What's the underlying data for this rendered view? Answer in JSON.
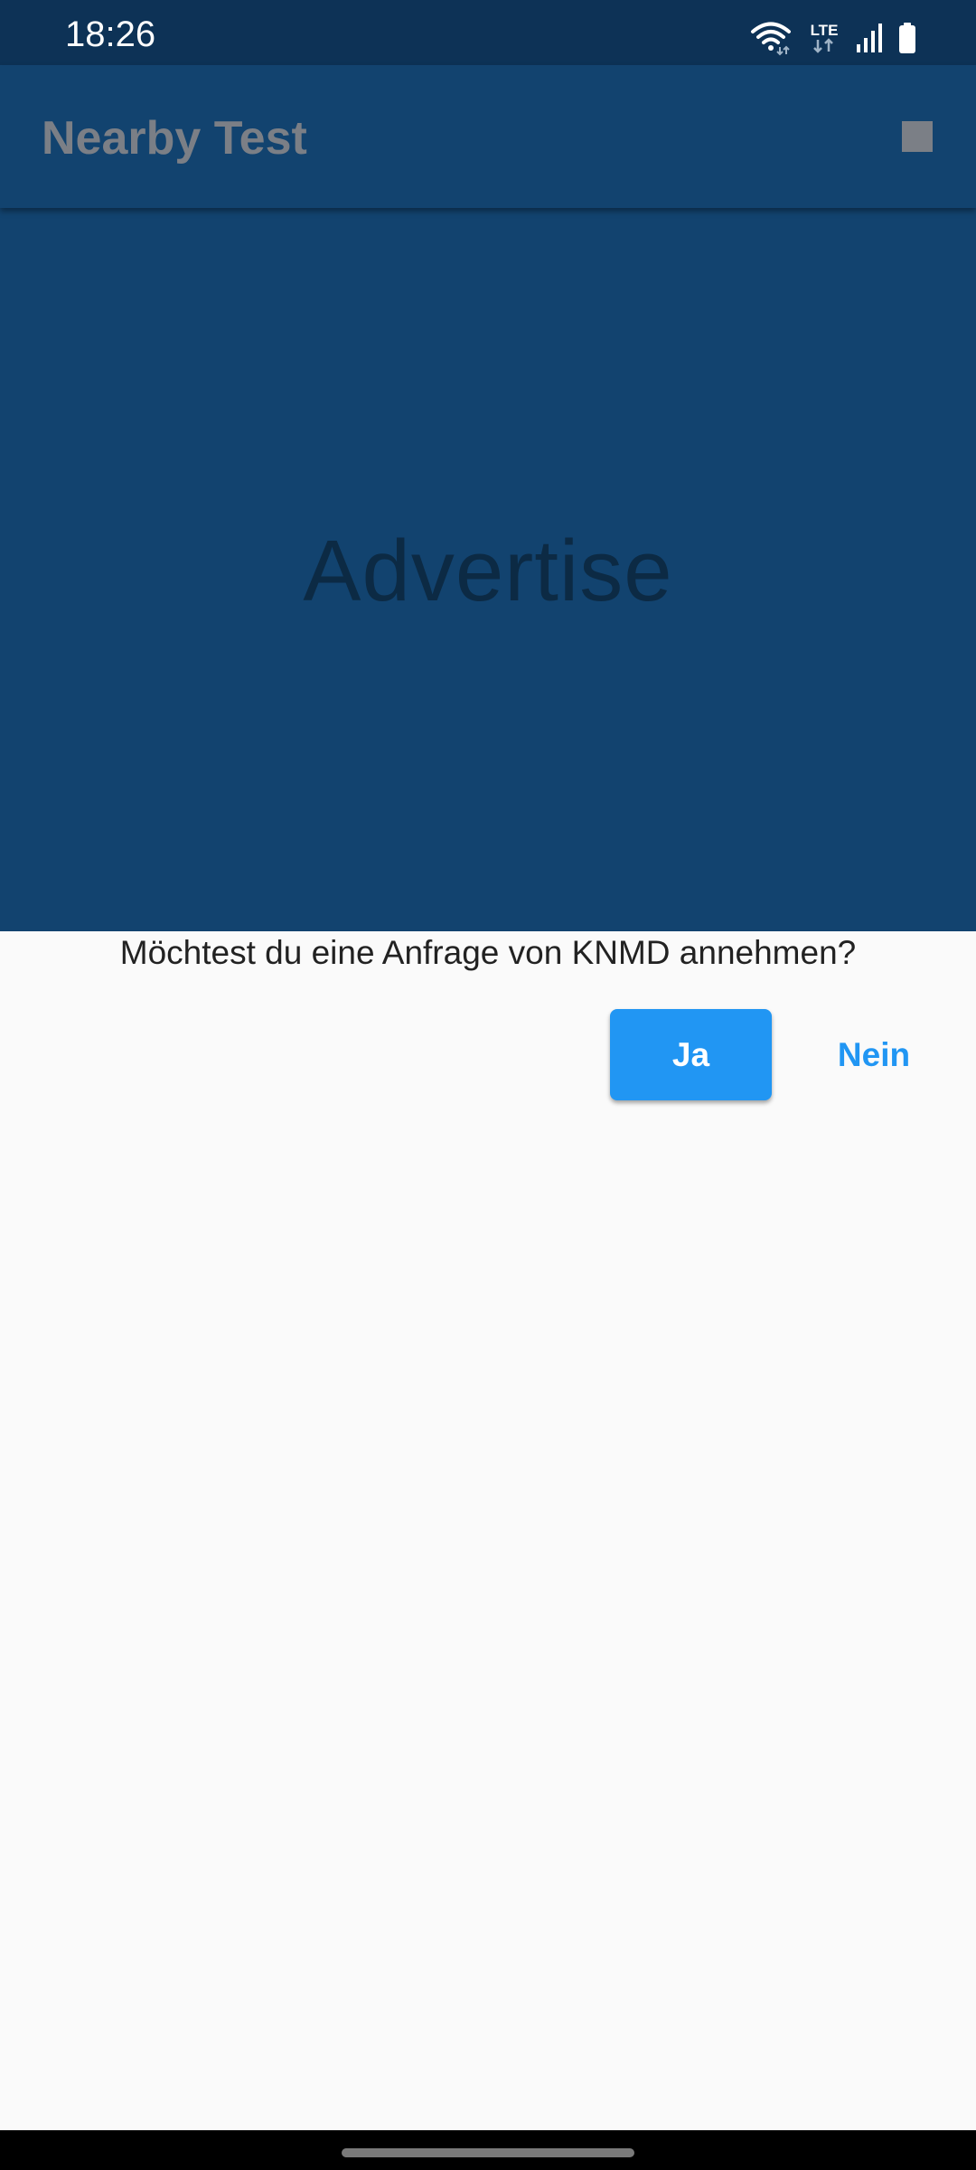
{
  "status_bar": {
    "time": "18:26",
    "network_label": "LTE",
    "icons": [
      "wifi-icon",
      "lte-icon",
      "signal-icon",
      "battery-icon"
    ]
  },
  "app_bar": {
    "title": "Nearby Test",
    "action_icon": "stop-icon"
  },
  "banner": {
    "label": "Advertise"
  },
  "dialog": {
    "question": "Möchtest du eine Anfrage von KNMD annehmen?",
    "accept_label": "Ja",
    "decline_label": "Nein"
  },
  "colors": {
    "status_bar": "#0d3256",
    "app_bar": "#12436f",
    "accent": "#2196f3",
    "background": "#fafafa"
  }
}
